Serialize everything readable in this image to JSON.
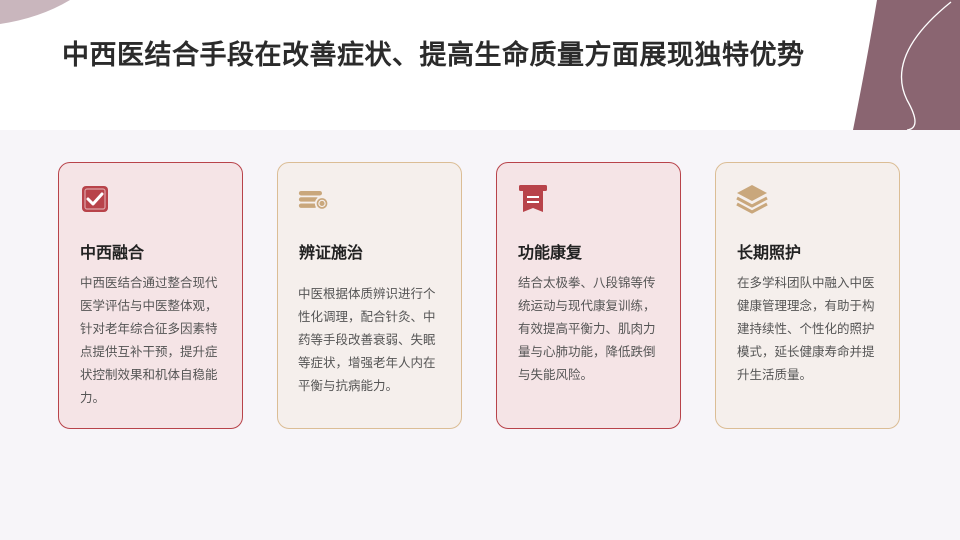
{
  "slide": {
    "title": "中西医结合手段在改善症状、提高生命质量方面展现独特优势"
  },
  "colors": {
    "accent_red": "#b8434a",
    "accent_tan": "#c9a77c",
    "corner_mauve": "#8a6571"
  },
  "cards": [
    {
      "icon": "checkbox-icon",
      "title": "中西融合",
      "desc": "中西医结合通过整合现代医学评估与中医整体观，针对老年综合征多因素特点提供互补干预，提升症状控制效果和机体自稳能力。"
    },
    {
      "icon": "coins-icon",
      "title": "辨证施治",
      "desc": "中医根据体质辨识进行个性化调理，配合针灸、中药等手段改善衰弱、失眠等症状，增强老年人内在平衡与抗病能力。"
    },
    {
      "icon": "document-icon",
      "title": "功能康复",
      "desc": "结合太极拳、八段锦等传统运动与现代康复训练，有效提高平衡力、肌肉力量与心肺功能，降低跌倒与失能风险。"
    },
    {
      "icon": "layers-icon",
      "title": "长期照护",
      "desc": "在多学科团队中融入中医健康管理理念，有助于构建持续性、个性化的照护模式，延长健康寿命并提升生活质量。"
    }
  ]
}
